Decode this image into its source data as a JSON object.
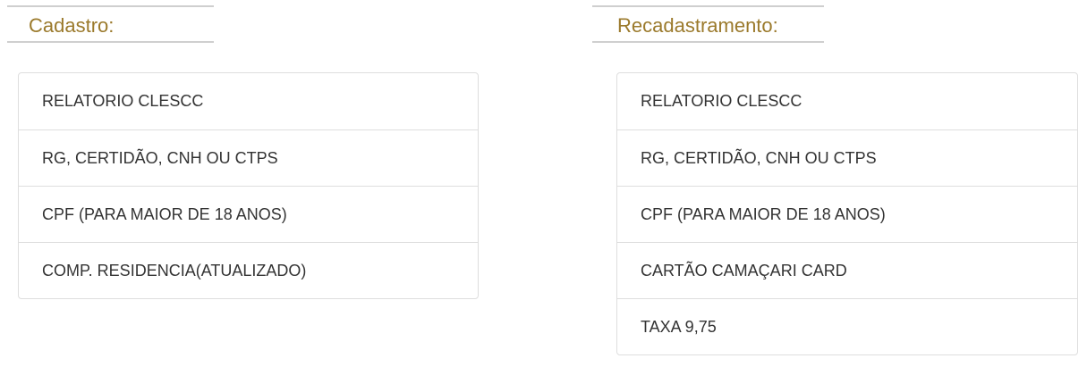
{
  "cadastro": {
    "title": "Cadastro:",
    "items": [
      "RELATORIO CLESCC",
      "RG, CERTIDÃO, CNH OU CTPS",
      "CPF (PARA MAIOR DE 18 ANOS)",
      "COMP. RESIDENCIA(ATUALIZADO)"
    ]
  },
  "recadastramento": {
    "title": "Recadastramento:",
    "items": [
      "RELATORIO CLESCC",
      "RG, CERTIDÃO, CNH OU CTPS",
      "CPF (PARA MAIOR DE 18 ANOS)",
      "CARTÃO CAMAÇARI CARD",
      "TAXA  9,75"
    ]
  },
  "colors": {
    "heading": "#9b7a2c",
    "border": "#dedede",
    "text": "#333333"
  }
}
